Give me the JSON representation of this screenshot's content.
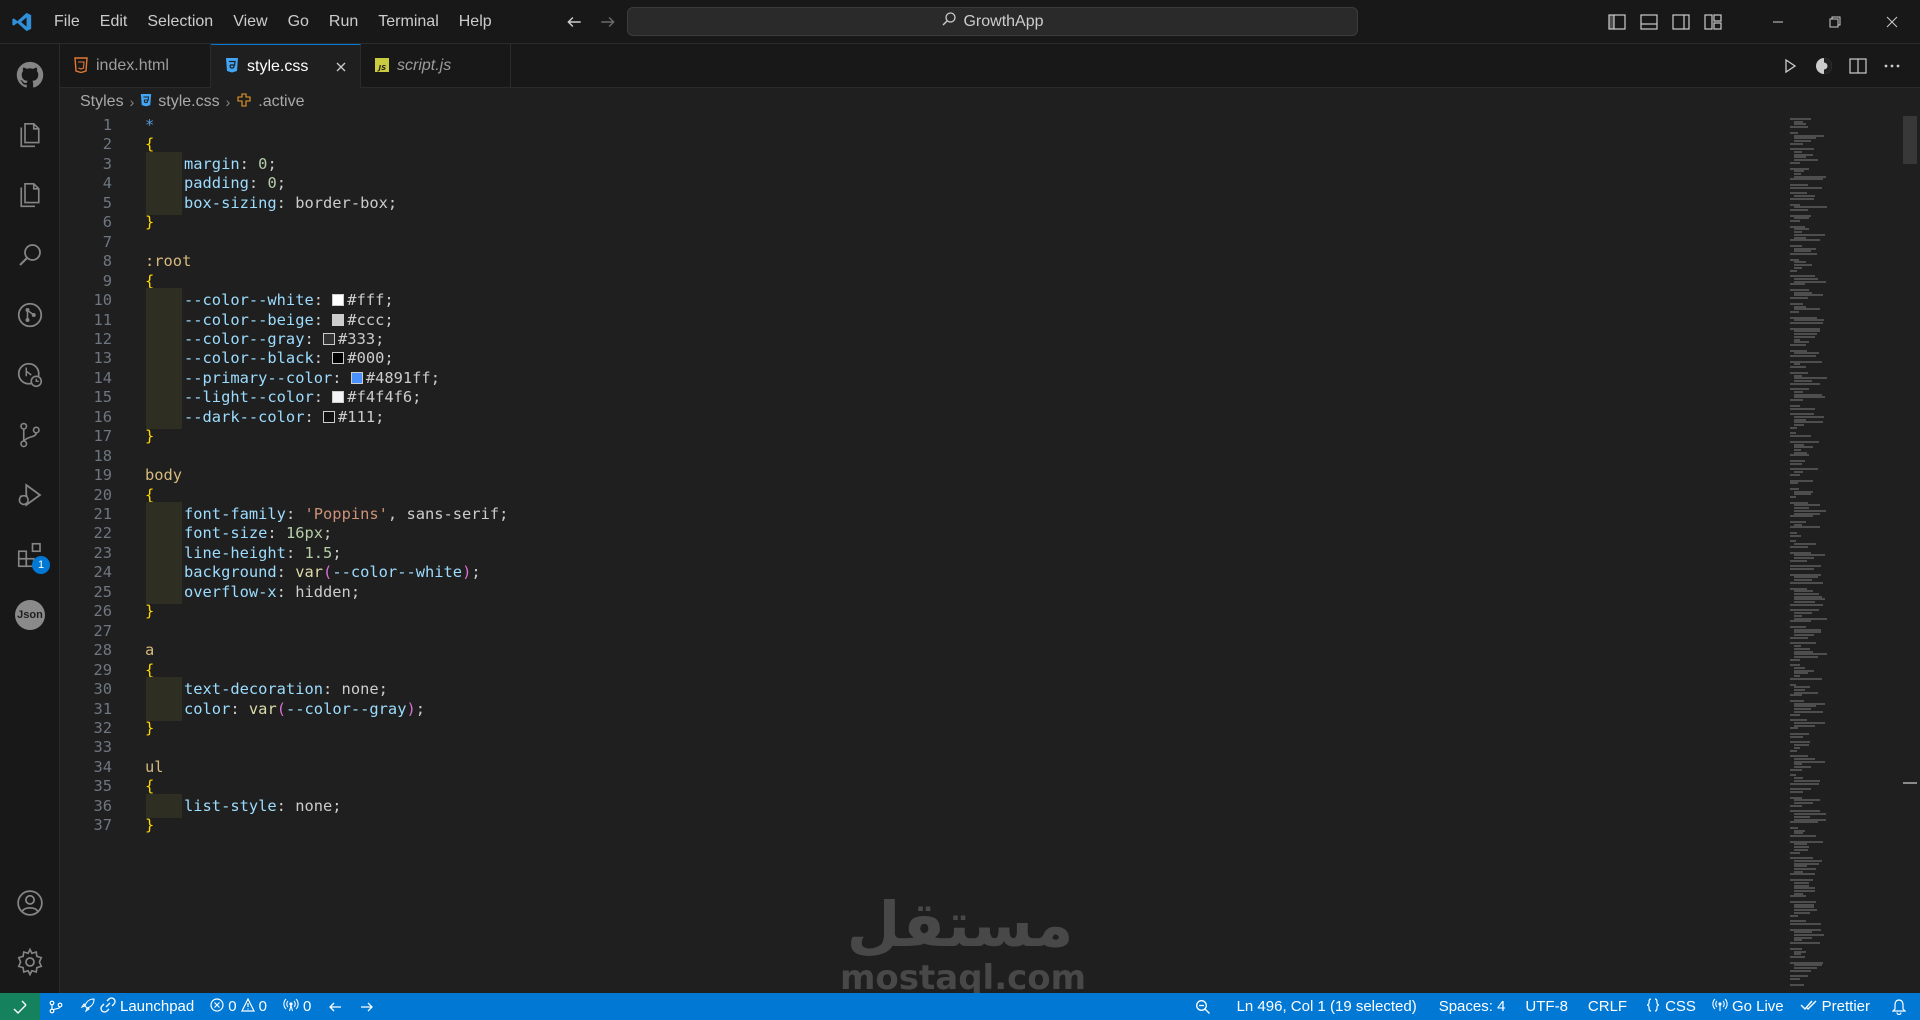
{
  "titlebar": {
    "menu": [
      "File",
      "Edit",
      "Selection",
      "View",
      "Go",
      "Run",
      "Terminal",
      "Help"
    ],
    "search_text": "GrowthApp"
  },
  "activity_bar": {
    "items": [
      "github-icon",
      "explorer-icon",
      "explorer-icon",
      "search-icon",
      "git-graph-icon",
      "git-history-icon",
      "source-control-icon",
      "run-debug-icon",
      "extensions-icon",
      "json-icon",
      "account-icon",
      "settings-gear-icon"
    ],
    "extensions_badge": "1",
    "json_label": "Json"
  },
  "tabs": [
    {
      "label": "index.html",
      "icon": "html-file-icon",
      "active": false
    },
    {
      "label": "style.css",
      "icon": "css-file-icon",
      "active": true
    },
    {
      "label": "script.js",
      "icon": "js-file-icon",
      "active": false,
      "italic": true
    }
  ],
  "breadcrumbs": {
    "folder": "Styles",
    "file": "style.css",
    "symbol": ".active"
  },
  "code_lines": [
    {
      "n": "1",
      "text": "*"
    },
    {
      "n": "2",
      "text": "{"
    },
    {
      "n": "3",
      "text": "margin: 0;"
    },
    {
      "n": "4",
      "text": "padding: 0;"
    },
    {
      "n": "5",
      "text": "box-sizing: border-box;"
    },
    {
      "n": "6",
      "text": "}"
    },
    {
      "n": "7",
      "text": ""
    },
    {
      "n": "8",
      "text": ":root"
    },
    {
      "n": "9",
      "text": "{"
    },
    {
      "n": "10",
      "text": "--color--white: #fff;"
    },
    {
      "n": "11",
      "text": "--color--beige: #ccc;"
    },
    {
      "n": "12",
      "text": "--color--gray: #333;"
    },
    {
      "n": "13",
      "text": "--color--black: #000;"
    },
    {
      "n": "14",
      "text": "--primary--color: #4891ff;"
    },
    {
      "n": "15",
      "text": "--light--color: #f4f4f6;"
    },
    {
      "n": "16",
      "text": "--dark--color: #111;"
    },
    {
      "n": "17",
      "text": "}"
    },
    {
      "n": "18",
      "text": ""
    },
    {
      "n": "19",
      "text": "body"
    },
    {
      "n": "20",
      "text": "{"
    },
    {
      "n": "21",
      "text": "font-family: 'Poppins', sans-serif;"
    },
    {
      "n": "22",
      "text": "font-size: 16px;"
    },
    {
      "n": "23",
      "text": "line-height: 1.5;"
    },
    {
      "n": "24",
      "text": "background: var(--color--white);"
    },
    {
      "n": "25",
      "text": "overflow-x: hidden;"
    },
    {
      "n": "26",
      "text": "}"
    },
    {
      "n": "27",
      "text": ""
    },
    {
      "n": "28",
      "text": "a"
    },
    {
      "n": "29",
      "text": "{"
    },
    {
      "n": "30",
      "text": "text-decoration: none;"
    },
    {
      "n": "31",
      "text": "color: var(--color--gray);"
    },
    {
      "n": "32",
      "text": "}"
    },
    {
      "n": "33",
      "text": ""
    },
    {
      "n": "34",
      "text": "ul"
    },
    {
      "n": "35",
      "text": "{"
    },
    {
      "n": "36",
      "text": "list-style: none;"
    },
    {
      "n": "37",
      "text": "}"
    }
  ],
  "swatches": {
    "white": "#ffffff",
    "beige": "#cccccc",
    "gray": "#333333",
    "black": "#000000",
    "primary": "#4891ff",
    "light": "#f4f4f6",
    "dark": "#111111"
  },
  "watermark": {
    "arabic": "مستقل",
    "latin": "mostaql.com"
  },
  "statusbar": {
    "launchpad": "Launchpad",
    "errors": "0",
    "warnings": "0",
    "ports": "0",
    "cursor": "Ln 496, Col 1 (19 selected)",
    "spaces": "Spaces: 4",
    "encoding": "UTF-8",
    "eol": "CRLF",
    "language": "CSS",
    "golive": "Go Live",
    "prettier": "Prettier"
  },
  "colors": {
    "accent": "#0078d4",
    "remote": "#16825d"
  }
}
